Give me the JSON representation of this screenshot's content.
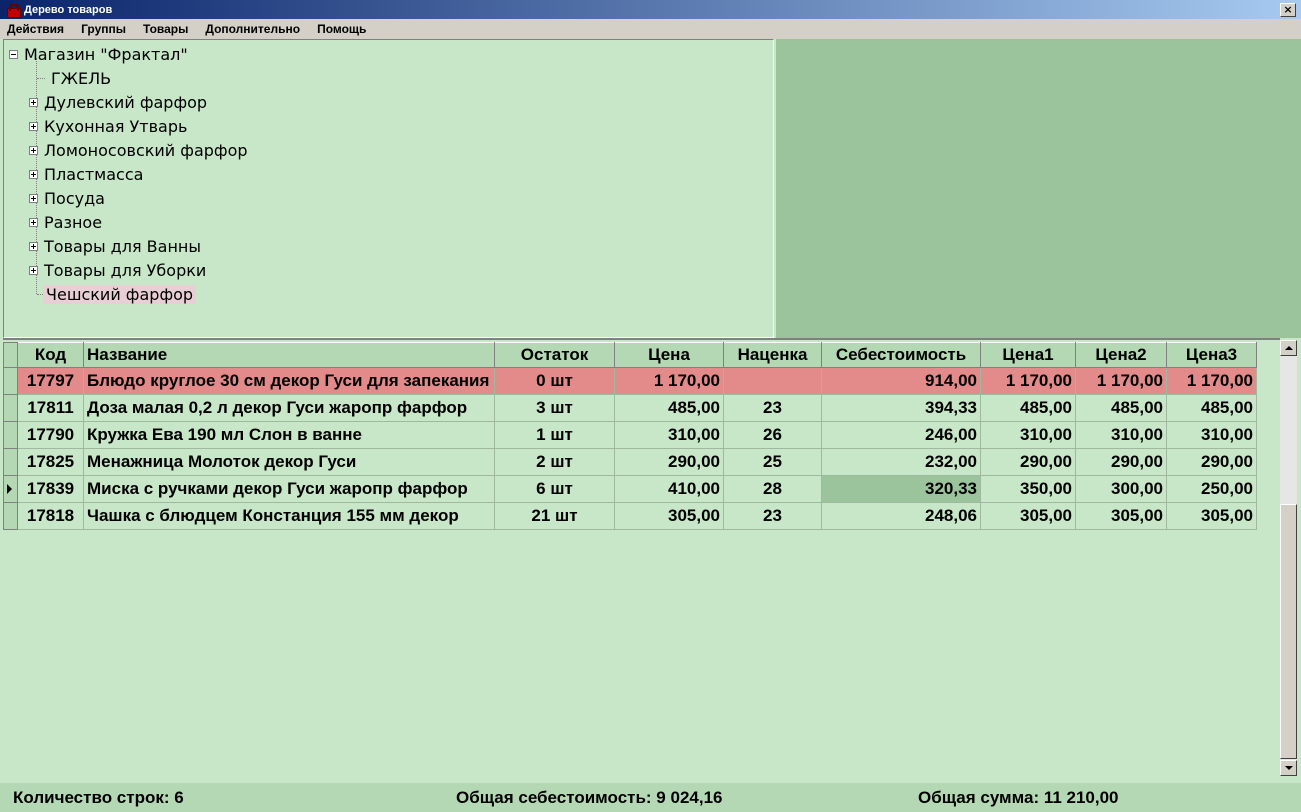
{
  "window": {
    "title": "Дерево товаров",
    "close_glyph": "×"
  },
  "menu": [
    "Действия",
    "Группы",
    "Товары",
    "Дополнительно",
    "Помощь"
  ],
  "tree": {
    "root": "Магазин \"Фрактал\"",
    "nodes": [
      {
        "label": "ГЖЕЛЬ",
        "expandable": false
      },
      {
        "label": "Дулевский фарфор",
        "expandable": true
      },
      {
        "label": "Кухонная Утварь",
        "expandable": true
      },
      {
        "label": "Ломоносовский фарфор",
        "expandable": true
      },
      {
        "label": "Пластмасса",
        "expandable": true
      },
      {
        "label": "Посуда",
        "expandable": true
      },
      {
        "label": "Разное",
        "expandable": true
      },
      {
        "label": "Товары для Ванны",
        "expandable": true
      },
      {
        "label": "Товары для Уборки",
        "expandable": true
      },
      {
        "label": "Чешский фарфор",
        "expandable": false,
        "selected": true
      }
    ]
  },
  "grid": {
    "columns": [
      "Код",
      "Название",
      "Остаток",
      "Цена",
      "Наценка",
      "Себестоимость",
      "Цена1",
      "Цена2",
      "Цена3"
    ],
    "rows": [
      {
        "code": "17797",
        "name": "Блюдо круглое 30 см декор Гуси для запекания",
        "stock": "0 шт",
        "price": "1 170,00",
        "markup": "",
        "cost": "914,00",
        "price1": "1 170,00",
        "price2": "1 170,00",
        "price3": "1 170,00",
        "highlight": true
      },
      {
        "code": "17811",
        "name": "Доза малая 0,2 л декор Гуси жаропр фарфор",
        "stock": "3 шт",
        "price": "485,00",
        "markup": "23",
        "cost": "394,33",
        "price1": "485,00",
        "price2": "485,00",
        "price3": "485,00"
      },
      {
        "code": "17790",
        "name": "Кружка Ева 190 мл Слон в ванне",
        "stock": "1 шт",
        "price": "310,00",
        "markup": "26",
        "cost": "246,00",
        "price1": "310,00",
        "price2": "310,00",
        "price3": "310,00"
      },
      {
        "code": "17825",
        "name": "Менажница Молоток декор Гуси",
        "stock": "2 шт",
        "price": "290,00",
        "markup": "25",
        "cost": "232,00",
        "price1": "290,00",
        "price2": "290,00",
        "price3": "290,00"
      },
      {
        "code": "17839",
        "name": "Миска с ручками декор Гуси жаропр фарфор",
        "stock": "6 шт",
        "price": "410,00",
        "markup": "28",
        "cost": "320,33",
        "price1": "350,00",
        "price2": "300,00",
        "price3": "250,00",
        "current": true
      },
      {
        "code": "17818",
        "name": "Чашка с блюдцем Констанция 155 мм декор",
        "stock": "21 шт",
        "price": "305,00",
        "markup": "23",
        "cost": "248,06",
        "price1": "305,00",
        "price2": "305,00",
        "price3": "305,00"
      }
    ]
  },
  "status": {
    "row_count": "Количество строк: 6",
    "total_cost": "Общая себестоимость: 9 024,16",
    "total_sum": "Общая сумма: 11 210,00"
  }
}
